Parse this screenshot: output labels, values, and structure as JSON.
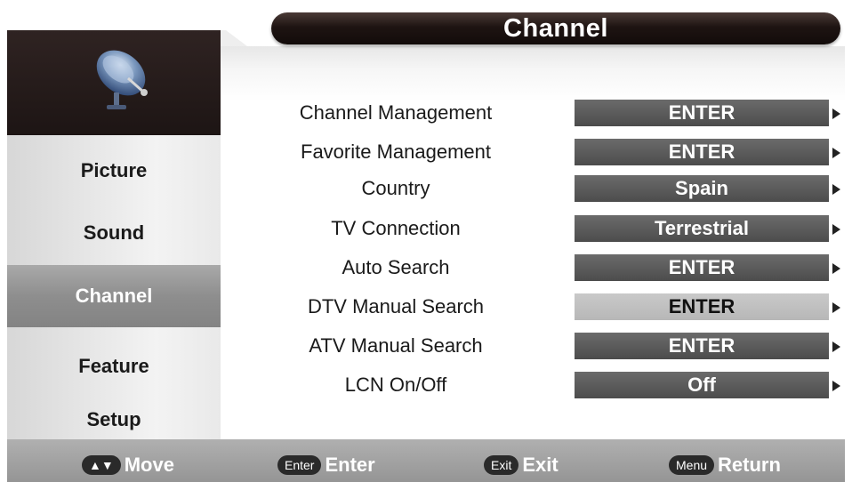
{
  "header": {
    "title": "Channel"
  },
  "sidebar": {
    "icon": "satellite-dish-icon",
    "items": [
      {
        "label": "Picture"
      },
      {
        "label": "Sound"
      },
      {
        "label": "Channel",
        "active": true
      },
      {
        "label": "Feature"
      },
      {
        "label": "Setup"
      }
    ]
  },
  "rows": [
    {
      "label": "Channel Management",
      "value": "ENTER"
    },
    {
      "label": "Favorite Management",
      "value": "ENTER"
    },
    {
      "label": "Country",
      "value": "Spain"
    },
    {
      "label": "TV Connection",
      "value": "Terrestrial"
    },
    {
      "label": "Auto Search",
      "value": "ENTER"
    },
    {
      "label": "DTV Manual Search",
      "value": "ENTER",
      "highlighted": true
    },
    {
      "label": "ATV Manual Search",
      "value": "ENTER"
    },
    {
      "label": "LCN On/Off",
      "value": "Off"
    }
  ],
  "footer": {
    "hints": [
      {
        "key": "▲▼",
        "label": "Move"
      },
      {
        "key": "Enter",
        "label": "Enter"
      },
      {
        "key": "Exit",
        "label": "Exit"
      },
      {
        "key": "Menu",
        "label": "Return"
      }
    ]
  },
  "colors": {
    "title_bar": "#1e1412",
    "button": "#555555",
    "button_highlight": "#c0c0c0",
    "active_nav": "#8e8e8e",
    "footer": "#a0a0a0"
  }
}
